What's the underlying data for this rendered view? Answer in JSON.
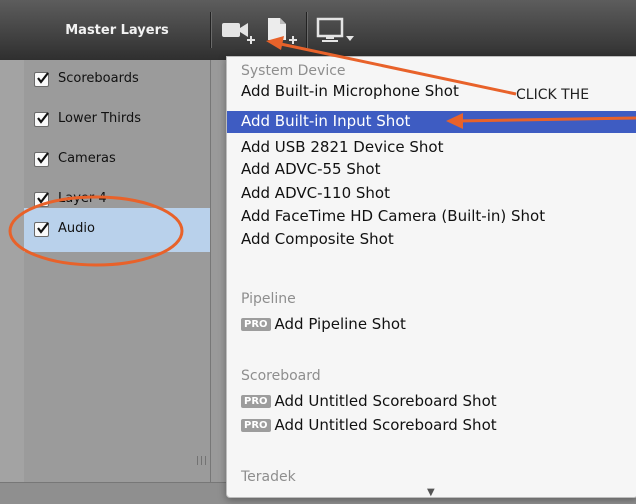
{
  "sidebar": {
    "title": "Master Layers",
    "items": [
      {
        "label": "Scoreboards",
        "checked": true,
        "selected": false
      },
      {
        "label": "Lower Thirds",
        "checked": true,
        "selected": false
      },
      {
        "label": "Cameras",
        "checked": true,
        "selected": false
      },
      {
        "label": "Layer 4",
        "checked": true,
        "selected": false
      },
      {
        "label": "Audio",
        "checked": true,
        "selected": true
      }
    ]
  },
  "toolbar": {
    "buttons": [
      {
        "icon": "camera-add-icon"
      },
      {
        "icon": "document-add-icon"
      },
      {
        "icon": "display-dropdown-icon"
      }
    ]
  },
  "menu": {
    "sections": [
      {
        "header": "System Device",
        "items": [
          {
            "label": "Add Built-in Microphone Shot"
          },
          {
            "label": "Add Built-in Input Shot"
          },
          {
            "label": "Add USB 2821 Device Shot"
          },
          {
            "label": "Add ADVC-55 Shot"
          },
          {
            "label": "Add ADVC-110 Shot"
          },
          {
            "label": "Add FaceTime HD Camera (Built-in) Shot"
          },
          {
            "label": "Add Composite Shot"
          }
        ]
      },
      {
        "header": "Pipeline",
        "items": [
          {
            "label": "Add Pipeline Shot",
            "badge": "PRO"
          }
        ]
      },
      {
        "header": "Scoreboard",
        "items": [
          {
            "label": "Add Untitled Scoreboard Shot",
            "badge": "PRO"
          },
          {
            "label": "Add Untitled Scoreboard Shot",
            "badge": "PRO"
          }
        ]
      },
      {
        "header": "Teradek",
        "items": []
      }
    ],
    "highlighted_item": "Add Built-in Input Shot"
  },
  "annotation": {
    "callout_text": "CLICK THE",
    "color": "#e8622a"
  },
  "colors": {
    "selection": "#3e5cc2",
    "sidebar_selected": "#b9d1eb",
    "toolbar": "#3d3d3d"
  }
}
